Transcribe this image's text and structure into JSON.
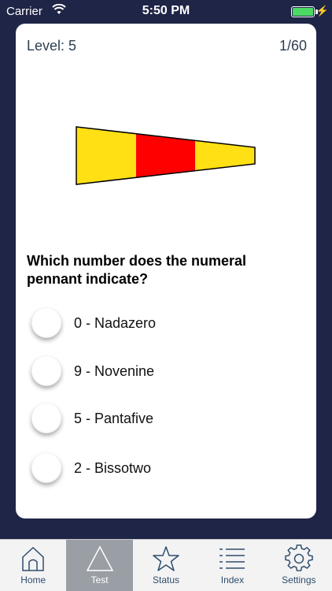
{
  "status_bar": {
    "carrier": "Carrier",
    "time": "5:50 PM"
  },
  "quiz": {
    "level": "Level: 5",
    "progress": "1/60",
    "question": "Which number does the numeral pennant indicate?",
    "flag_colors": [
      "#ffe014",
      "#ff0000",
      "#ffe014"
    ],
    "options": [
      {
        "label": "0 - Nadazero"
      },
      {
        "label": "9 - Novenine"
      },
      {
        "label": "5 - Pantafive"
      },
      {
        "label": "2 - Bissotwo"
      }
    ]
  },
  "tab_bar": {
    "tabs": [
      {
        "label": "Home",
        "icon": "home-icon"
      },
      {
        "label": "Test",
        "icon": "triangle-icon",
        "active": true
      },
      {
        "label": "Status",
        "icon": "star-icon"
      },
      {
        "label": "Index",
        "icon": "list-icon"
      },
      {
        "label": "Settings",
        "icon": "gear-icon"
      }
    ]
  }
}
